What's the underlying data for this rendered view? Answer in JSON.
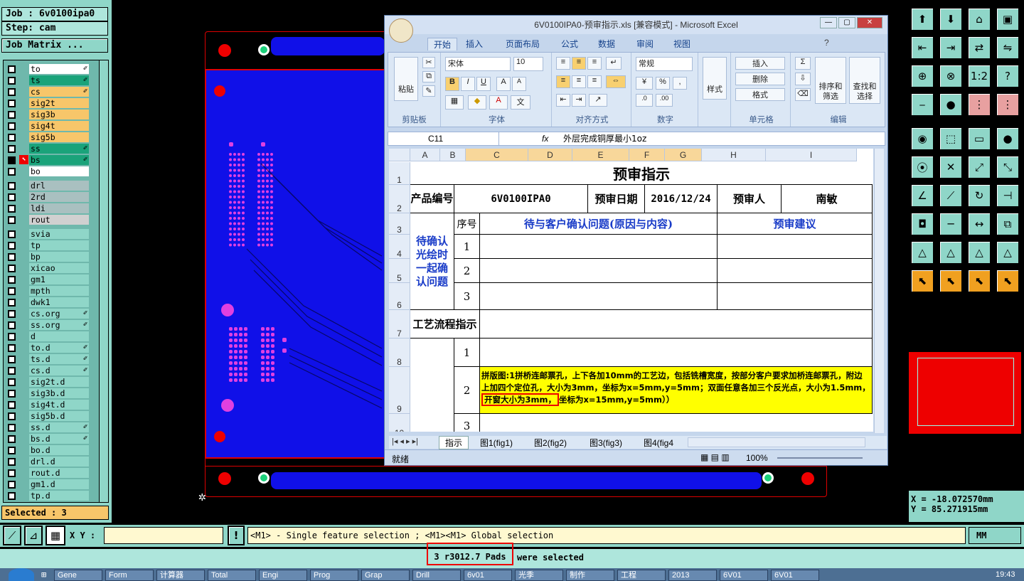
{
  "job": {
    "job_label": "Job :",
    "job_name": "6v0100ipa0",
    "step_label": "Step:",
    "step_name": "cam",
    "matrix_button": "Job Matrix ..."
  },
  "layers": [
    {
      "name": "to",
      "color": "#ffffff",
      "flag": "✐"
    },
    {
      "name": "ts",
      "color": "#1aa37a",
      "flag": "✐"
    },
    {
      "name": "cs",
      "color": "#f7c66a",
      "flag": "✐"
    },
    {
      "name": "sig2t",
      "color": "#f7c66a",
      "flag": ""
    },
    {
      "name": "sig3b",
      "color": "#f7c66a",
      "flag": ""
    },
    {
      "name": "sig4t",
      "color": "#f7c66a",
      "flag": ""
    },
    {
      "name": "sig5b",
      "color": "#f7c66a",
      "flag": ""
    },
    {
      "name": "ss",
      "color": "#1aa37a",
      "flag": "✐"
    },
    {
      "name": "bs",
      "color": "#1aa37a",
      "flag": "✐"
    },
    {
      "name": "bo",
      "color": "#ffffff",
      "flag": ""
    },
    {
      "name": "drl",
      "color": "#a9c0c0",
      "flag": ""
    },
    {
      "name": "2rd",
      "color": "#a9c0c0",
      "flag": ""
    },
    {
      "name": "ldi",
      "color": "#a9c0c0",
      "flag": ""
    },
    {
      "name": "rout",
      "color": "#d0d0d0",
      "flag": ""
    },
    {
      "name": "svia",
      "color": "#8fd6c8",
      "flag": ""
    },
    {
      "name": "tp",
      "color": "#8fd6c8",
      "flag": ""
    },
    {
      "name": "bp",
      "color": "#8fd6c8",
      "flag": ""
    },
    {
      "name": "xicao",
      "color": "#8fd6c8",
      "flag": ""
    },
    {
      "name": "gm1",
      "color": "#8fd6c8",
      "flag": ""
    },
    {
      "name": "mpth",
      "color": "#8fd6c8",
      "flag": ""
    },
    {
      "name": "dwk1",
      "color": "#8fd6c8",
      "flag": ""
    },
    {
      "name": "cs.org",
      "color": "#8fd6c8",
      "flag": "✐"
    },
    {
      "name": "ss.org",
      "color": "#8fd6c8",
      "flag": "✐"
    },
    {
      "name": "d",
      "color": "#8fd6c8",
      "flag": ""
    },
    {
      "name": "to.d",
      "color": "#8fd6c8",
      "flag": "✐"
    },
    {
      "name": "ts.d",
      "color": "#8fd6c8",
      "flag": "✐"
    },
    {
      "name": "cs.d",
      "color": "#8fd6c8",
      "flag": "✐"
    },
    {
      "name": "sig2t.d",
      "color": "#8fd6c8",
      "flag": ""
    },
    {
      "name": "sig3b.d",
      "color": "#8fd6c8",
      "flag": ""
    },
    {
      "name": "sig4t.d",
      "color": "#8fd6c8",
      "flag": ""
    },
    {
      "name": "sig5b.d",
      "color": "#8fd6c8",
      "flag": ""
    },
    {
      "name": "ss.d",
      "color": "#8fd6c8",
      "flag": "✐"
    },
    {
      "name": "bs.d",
      "color": "#8fd6c8",
      "flag": "✐"
    },
    {
      "name": "bo.d",
      "color": "#8fd6c8",
      "flag": ""
    },
    {
      "name": "drl.d",
      "color": "#8fd6c8",
      "flag": ""
    },
    {
      "name": "rout.d",
      "color": "#8fd6c8",
      "flag": ""
    },
    {
      "name": "gm1.d",
      "color": "#8fd6c8",
      "flag": ""
    },
    {
      "name": "tp.d",
      "color": "#8fd6c8",
      "flag": ""
    }
  ],
  "selected_text": "Selected : 3",
  "command": {
    "xy_label": "X Y :",
    "xy_value": "",
    "hint": "<M1> - Single feature selection ; <M1><M1> Global selection",
    "units": "MM"
  },
  "status": {
    "highlight": "3 r3012.7 Pads",
    "rest": "were selected"
  },
  "coords": {
    "x": "X = -18.072570mm",
    "y": "Y = 85.271915mm"
  },
  "excel": {
    "title": "6V0100IPA0-预审指示.xls [兼容模式] - Microsoft Excel",
    "tabs": [
      "开始",
      "插入",
      "页面布局",
      "公式",
      "数据",
      "审阅",
      "视图"
    ],
    "groups": {
      "clipboard": "剪贴板",
      "font": "字体",
      "align": "对齐方式",
      "number": "数字",
      "styles": "样式",
      "cells": "单元格",
      "edit": "编辑"
    },
    "paste": "粘贴",
    "font_name": "宋体",
    "font_size": "10",
    "number_format": "常规",
    "insert": "插入",
    "delete": "删除",
    "format": "格式",
    "sort": "排序和\n筛选",
    "find": "查找和\n选择",
    "namebox": "C11",
    "formula": "外层完成铜厚最小1oz",
    "columns": [
      "A",
      "B",
      "C",
      "D",
      "E",
      "F",
      "G",
      "H",
      "I"
    ],
    "rows": [
      "1",
      "2",
      "3",
      "4",
      "5",
      "6",
      "7",
      "8",
      "9",
      "10"
    ],
    "cells": {
      "title": "预审指示",
      "product_label": "产品编号",
      "product": "6V0100IPA0",
      "date_label": "预审日期",
      "date": "2016/12/24",
      "reviewer_label": "预审人",
      "reviewer": "南敏",
      "seq": "序号",
      "question_hdr": "待与客户确认问题(原因与内容)",
      "suggest_hdr": "预审建议",
      "confirm_label": "待确认光绘时一起确认问题",
      "n1": "1",
      "n2": "2",
      "n3": "3",
      "process_label": "工艺流程指示",
      "p1": "1",
      "p2": "2",
      "p3": "3",
      "note_a": "拼版图:1拼桥连邮票孔，上下各加10mm的工艺边，包括铣槽宽度，按部分客户要求加桥连邮票孔，附边上加四个定位孔，大小为3mm，坐标为x=5mm,y=5mm；双面任意各加三个反光点，大小为1.5mm，",
      "note_b": "开窗大小为3mm，",
      "note_c": "坐标为x=15mm,y=5mm））"
    },
    "sheet_tabs": [
      "指示",
      "图1(fig1)",
      "图2(fig2)",
      "图3(fig3)",
      "图4(fig4"
    ],
    "ready": "就绪",
    "zoom": "100%"
  },
  "taskbar": [
    "Gene",
    "Form",
    "计算器",
    "Total",
    "Engi",
    "Prog",
    "Grap",
    "Drill",
    "6v01",
    "光季",
    "制作",
    "工程",
    "2013",
    "6V01",
    "6V01"
  ],
  "clock": "19:43",
  "colors": {
    "panel": "#8fd6c8",
    "board": "#1010e8",
    "outline": "#dd0000",
    "pad": "#e040e0",
    "highlight": "#ffff00"
  }
}
